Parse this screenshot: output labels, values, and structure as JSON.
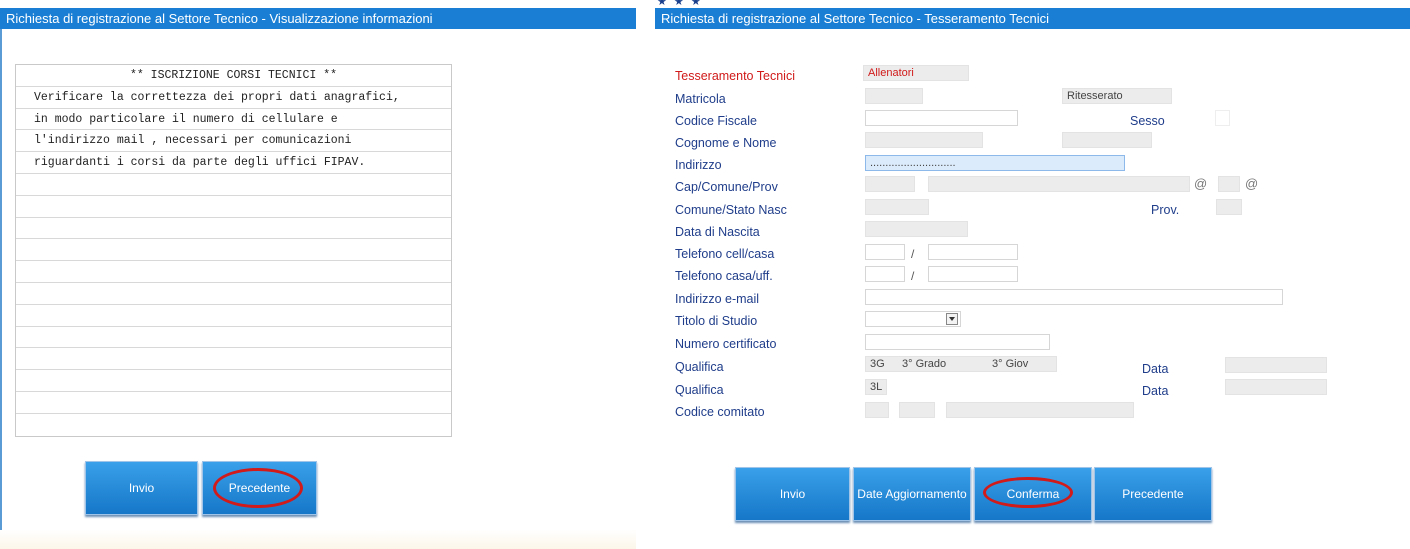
{
  "left": {
    "title": "Richiesta di registrazione al Settore Tecnico - Visualizzazione informazioni",
    "info_lines": [
      "** ISCRIZIONE CORSI TECNICI **",
      "Verificare la correttezza dei propri dati anagrafici,",
      "in modo particolare il numero di cellulare e",
      "l'indirizzo mail , necessari per comunicazioni",
      "riguardanti i corsi da parte degli uffici FIPAV.",
      "",
      "",
      "",
      "",
      "",
      "",
      "",
      "",
      "",
      "",
      "",
      ""
    ],
    "buttons": {
      "invio": "Invio",
      "precedente": "Precedente"
    }
  },
  "right": {
    "stars": "★ ★ ★",
    "title": "Richiesta di registrazione al Settore Tecnico - Tesseramento Tecnici",
    "labels": {
      "tesseramento": "Tesseramento Tecnici",
      "matricola": "Matricola",
      "codice_fiscale": "Codice Fiscale",
      "cognome_nome": "Cognome e Nome",
      "indirizzo": "Indirizzo",
      "cap_comune_prov": "Cap/Comune/Prov",
      "comune_stato_nasc": "Comune/Stato Nasc",
      "data_nascita": "Data di Nascita",
      "telefono_cell": "Telefono cell/casa",
      "telefono_uff": "Telefono casa/uff.",
      "email": "Indirizzo e-mail",
      "titolo_studio": "Titolo di Studio",
      "numero_certificato": "Numero certificato",
      "qualifica1": "Qualifica",
      "qualifica2": "Qualifica",
      "codice_comitato": "Codice comitato",
      "sesso": "Sesso",
      "prov": "Prov.",
      "data1": "Data",
      "data2": "Data",
      "slash": "/",
      "at": "@"
    },
    "values": {
      "tesseramento": "Allenatori",
      "ritesserato": "Ritesserato",
      "indirizzo": "............................",
      "qualifica1_code": "3G",
      "qualifica1_grade": "3° Grado",
      "qualifica1_extra": "3° Giov",
      "qualifica2_code": "3L"
    },
    "buttons": {
      "invio": "Invio",
      "date_aggiornamento": "Date Aggiornamento",
      "conferma": "Conferma",
      "precedente": "Precedente"
    }
  },
  "colors": {
    "title_bar": "#1a7fd4",
    "label": "#1f3d8a",
    "highlight_red": "#d11a1a",
    "button": "#2589d8"
  }
}
